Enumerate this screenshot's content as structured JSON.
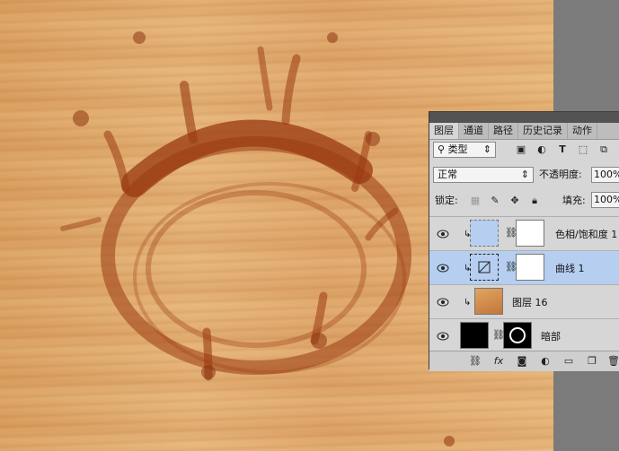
{
  "panel": {
    "tabs": [
      "图层",
      "通道",
      "路径",
      "历史记录",
      "动作"
    ],
    "active_tab": 0,
    "filter_label": "类型",
    "blend_mode": "正常",
    "opacity_label": "不透明度:",
    "opacity_value": "100%",
    "lock_label": "锁定:",
    "fill_label": "填充:",
    "fill_value": "100%",
    "layers": [
      {
        "name": "色相/饱和度 1",
        "selected": false,
        "clipped": true
      },
      {
        "name": "曲线 1",
        "selected": true,
        "clipped": true
      },
      {
        "name": "图层 16",
        "selected": false,
        "clipped": true
      },
      {
        "name": "暗部",
        "selected": false,
        "clipped": false
      }
    ]
  },
  "colors": {
    "selected_layer": "#b6cff1",
    "panel": "#d6d6d6",
    "wood": "#e0a96a",
    "splash": "#9a3a12"
  }
}
